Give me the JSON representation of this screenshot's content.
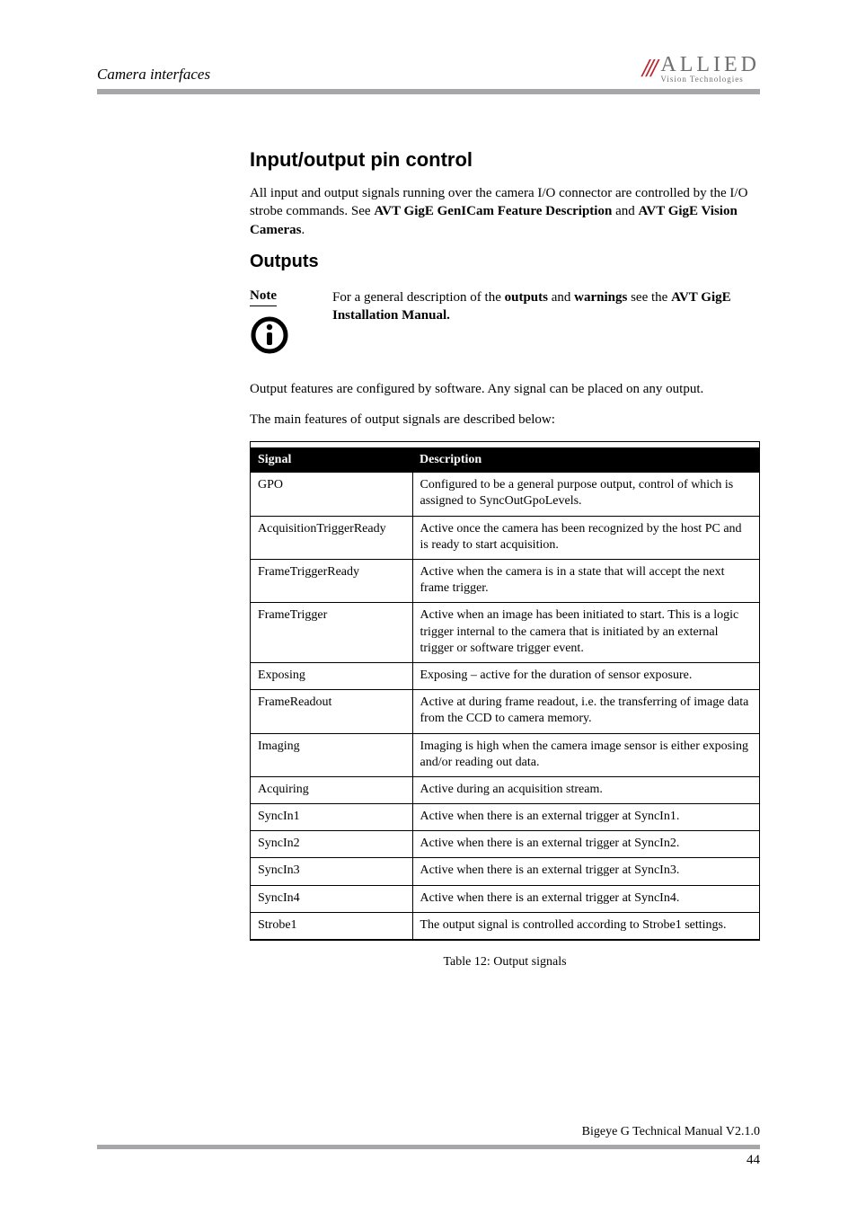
{
  "header": {
    "section": "Camera interfaces"
  },
  "logo": {
    "main": "ALLIED",
    "sub": "Vision Technologies"
  },
  "h1": "Input/output pin control",
  "intro_html": "All input and output signals running over the camera I/O connector are controlled by the I/O strobe commands. See <b>AVT GigE GenICam Feature Description</b> and <b>AVT GigE Vision Cameras</b>.",
  "h2": "Outputs",
  "note": {
    "label": "Note",
    "text_html": "For a general description of the <b>outputs</b> and <b>warnings</b> see the <b>AVT GigE Installation Manual.</b>"
  },
  "post_note_1": "Output features are configured by software. Any signal can be placed on any output.",
  "post_note_2": "The main features of output signals are described below:",
  "table": {
    "col1": "Signal",
    "col2": "Description",
    "rows": [
      {
        "signal": "GPO",
        "desc": "Configured to be a general purpose output, control of which is assigned to SyncOutGpoLevels."
      },
      {
        "signal": "AcquisitionTriggerReady",
        "desc": "Active once the camera has been recognized by the host PC and is ready to start acquisition."
      },
      {
        "signal": "FrameTriggerReady",
        "desc": "Active when the camera is in a state that will accept the next frame trigger."
      },
      {
        "signal": "FrameTrigger",
        "desc": "Active when an image has been initiated to start. This is a logic trigger internal to the camera that is initiated by an external trigger or software trigger event."
      },
      {
        "signal": "Exposing",
        "desc": "Exposing – active for the duration of sensor exposure."
      },
      {
        "signal": "FrameReadout",
        "desc": "Active at during frame readout, i.e. the transferring of image data from the CCD to camera memory."
      },
      {
        "signal": "Imaging",
        "desc": "Imaging is high when the camera image sensor is either exposing and/or reading out data."
      },
      {
        "signal": "Acquiring",
        "desc": "Active during an acquisition stream."
      },
      {
        "signal": "SyncIn1",
        "desc": "Active when there is an external trigger at SyncIn1."
      },
      {
        "signal": "SyncIn2",
        "desc": "Active when there is an external trigger at SyncIn2."
      },
      {
        "signal": "SyncIn3",
        "desc": "Active when there is an external trigger at SyncIn3."
      },
      {
        "signal": "SyncIn4",
        "desc": "Active when there is an external trigger at SyncIn4."
      },
      {
        "signal": "Strobe1",
        "desc": "The output signal is controlled according to Strobe1 settings."
      }
    ],
    "caption": "Table 12: Output signals"
  },
  "footer": {
    "doc": "Bigeye G Technical Manual V2.1.0",
    "page": "44"
  }
}
